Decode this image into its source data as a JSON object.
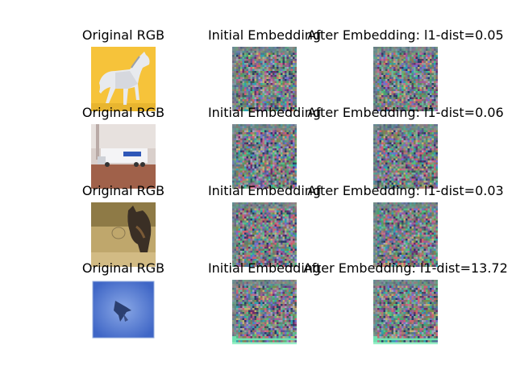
{
  "figure": {
    "rows": [
      {
        "original_title": "Original RGB",
        "initial_title": "Initial Embedding",
        "after_title": "After Embedding: l1-dist=0.05",
        "original_image": "white-horse-on-yellow-background"
      },
      {
        "original_title": "Original RGB",
        "initial_title": "Initial Embedding",
        "after_title": "After Embedding: l1-dist=0.06",
        "original_image": "toy-truck-on-brown-floor"
      },
      {
        "original_title": "Original RGB",
        "initial_title": "Initial Embedding",
        "after_title": "After Embedding: l1-dist=0.03",
        "original_image": "cat-on-tan-background"
      },
      {
        "original_title": "Original RGB",
        "initial_title": "Initial Embedding",
        "after_title": "After Embedding: l1-dist=13.72",
        "original_image": "dark-bird-on-blue-background"
      }
    ]
  }
}
